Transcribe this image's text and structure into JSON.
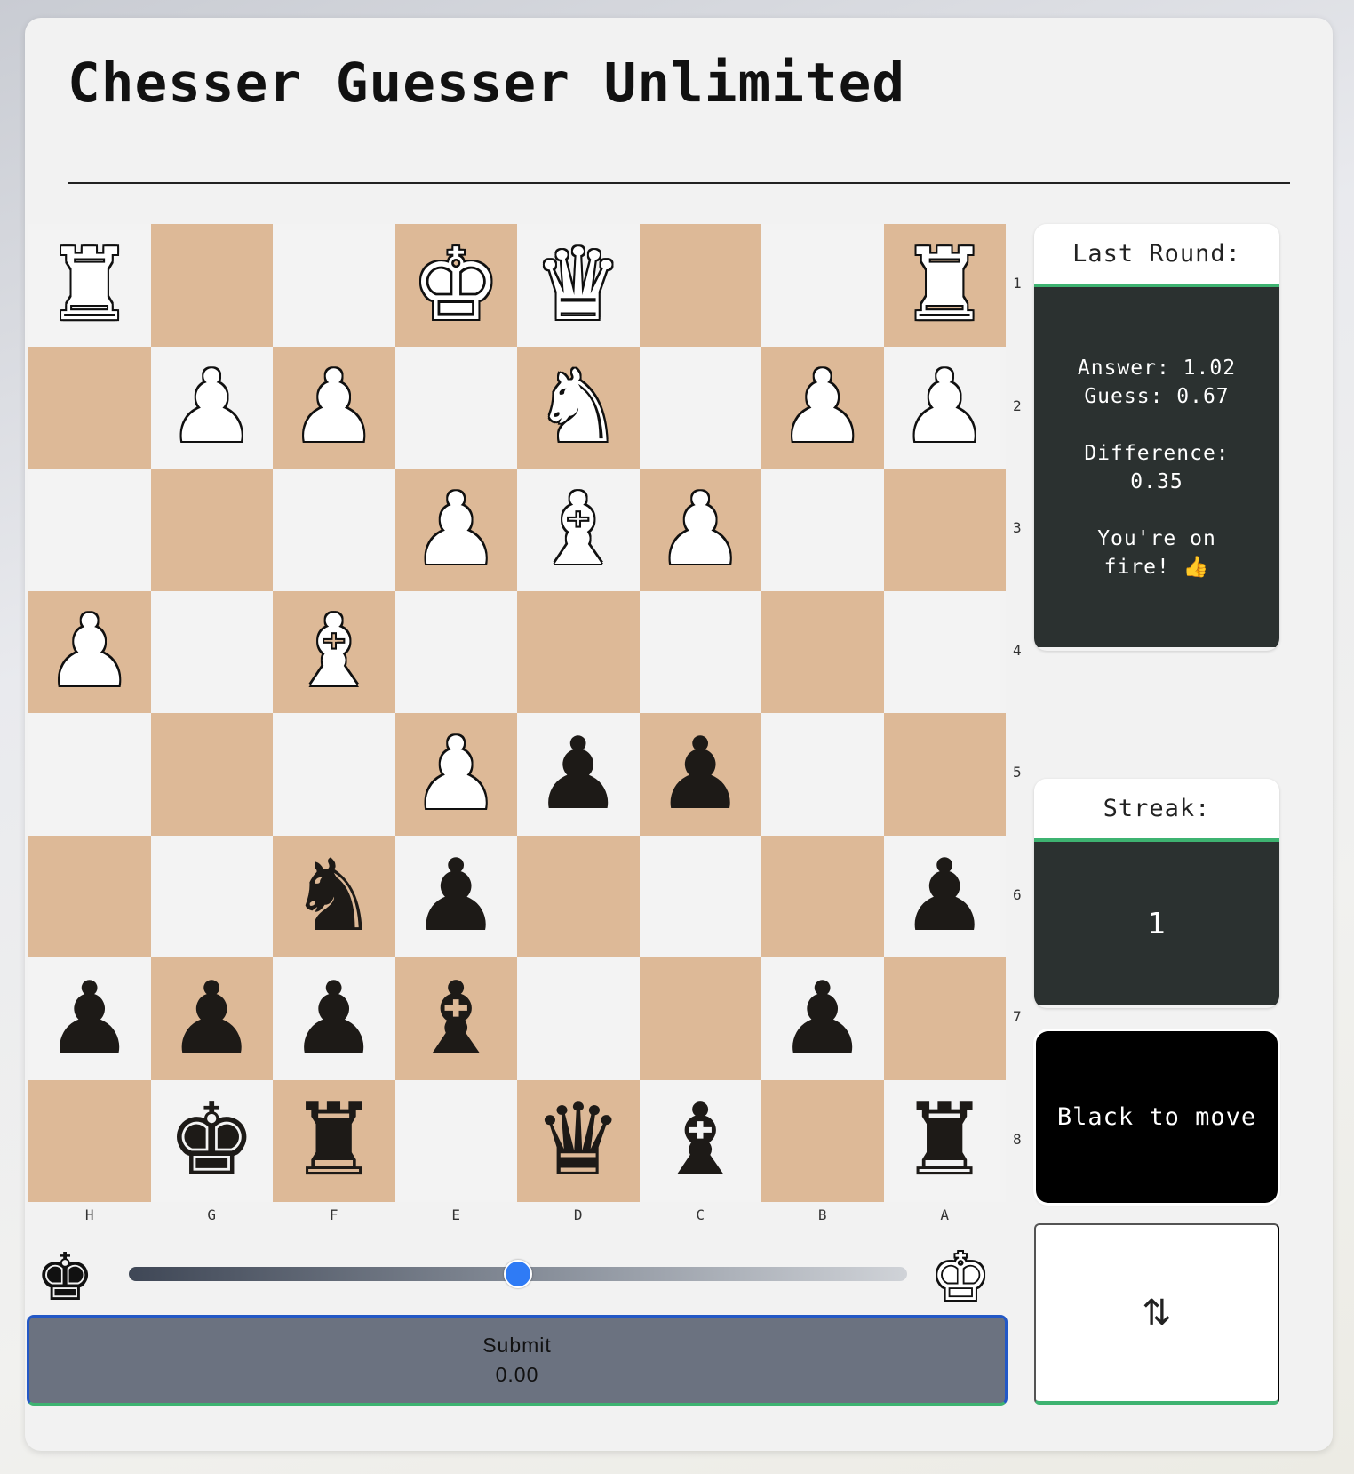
{
  "title": "Chesser Guesser Unlimited",
  "board": {
    "files": [
      "H",
      "G",
      "F",
      "E",
      "D",
      "C",
      "B",
      "A"
    ],
    "ranks": [
      "1",
      "2",
      "3",
      "4",
      "5",
      "6",
      "7",
      "8"
    ],
    "rows": [
      [
        {
          "p": "rook",
          "c": "w",
          "g": "♜"
        },
        null,
        null,
        {
          "p": "king",
          "c": "w",
          "g": "♚"
        },
        {
          "p": "queen",
          "c": "w",
          "g": "♛"
        },
        null,
        null,
        {
          "p": "rook",
          "c": "w",
          "g": "♜"
        }
      ],
      [
        null,
        {
          "p": "pawn",
          "c": "w",
          "g": "♟"
        },
        {
          "p": "pawn",
          "c": "w",
          "g": "♟"
        },
        null,
        {
          "p": "knight",
          "c": "w",
          "g": "♞"
        },
        null,
        {
          "p": "pawn",
          "c": "w",
          "g": "♟"
        },
        {
          "p": "pawn",
          "c": "w",
          "g": "♟"
        }
      ],
      [
        null,
        null,
        null,
        {
          "p": "pawn",
          "c": "w",
          "g": "♟"
        },
        {
          "p": "bishop",
          "c": "w",
          "g": "♝"
        },
        {
          "p": "pawn",
          "c": "w",
          "g": "♟"
        },
        null,
        null
      ],
      [
        {
          "p": "pawn",
          "c": "w",
          "g": "♟"
        },
        null,
        {
          "p": "bishop",
          "c": "w",
          "g": "♝"
        },
        null,
        null,
        null,
        null,
        null
      ],
      [
        null,
        null,
        null,
        {
          "p": "pawn",
          "c": "w",
          "g": "♟"
        },
        {
          "p": "pawn",
          "c": "b",
          "g": "♟"
        },
        {
          "p": "pawn",
          "c": "b",
          "g": "♟"
        },
        null,
        null
      ],
      [
        null,
        null,
        {
          "p": "knight",
          "c": "b",
          "g": "♞"
        },
        {
          "p": "pawn",
          "c": "b",
          "g": "♟"
        },
        null,
        null,
        null,
        {
          "p": "pawn",
          "c": "b",
          "g": "♟"
        }
      ],
      [
        {
          "p": "pawn",
          "c": "b",
          "g": "♟"
        },
        {
          "p": "pawn",
          "c": "b",
          "g": "♟"
        },
        {
          "p": "pawn",
          "c": "b",
          "g": "♟"
        },
        {
          "p": "bishop",
          "c": "b",
          "g": "♝"
        },
        null,
        null,
        {
          "p": "pawn",
          "c": "b",
          "g": "♟"
        },
        null
      ],
      [
        null,
        {
          "p": "king",
          "c": "b",
          "g": "♚"
        },
        {
          "p": "rook",
          "c": "b",
          "g": "♜"
        },
        null,
        {
          "p": "queen",
          "c": "b",
          "g": "♛"
        },
        {
          "p": "bishop",
          "c": "b",
          "g": "♝"
        },
        null,
        {
          "p": "rook",
          "c": "b",
          "g": "♜"
        }
      ]
    ]
  },
  "slider": {
    "left_icon": "black-king-icon",
    "right_icon": "white-king-icon",
    "left_glyph": "♚",
    "right_glyph": "♚",
    "value_fraction": 0.5
  },
  "submit": {
    "label": "Submit",
    "value": "0.00"
  },
  "last_round": {
    "title": "Last Round:",
    "answer": "Answer: 1.02",
    "guess": "Guess: 0.67",
    "difference_label": "Difference:",
    "difference_value": "0.35",
    "message_line1": "You're on",
    "message_line2": "fire! 👍"
  },
  "streak": {
    "title": "Streak:",
    "value": "1"
  },
  "to_move": "Black to move",
  "flip_button": {
    "icon": "swap-vertical-icon",
    "glyph": "⇅"
  },
  "colors": {
    "dark_square": "#ddb997",
    "light_square": "#f3f3f3",
    "accent": "#3eb371",
    "slider_thumb": "#2f7bf5"
  }
}
